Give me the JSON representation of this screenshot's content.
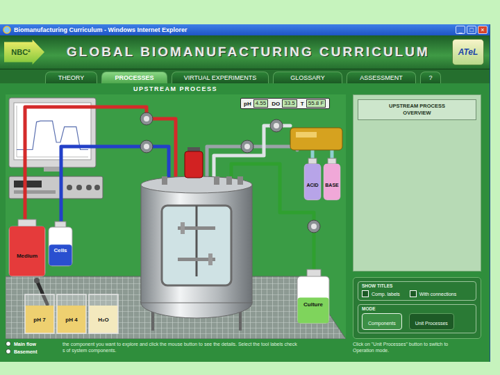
{
  "window": {
    "title": "Biomanufacturing Curriculum - Windows Internet Explorer",
    "controls": [
      "_",
      "□",
      "×"
    ]
  },
  "header": {
    "logo_left": "NBC²",
    "title": "GLOBAL BIOMANUFACTURING CURRICULUM",
    "logo_right": "ATeL"
  },
  "tabs": [
    {
      "label": "THEORY",
      "selected": false
    },
    {
      "label": "PROCESSES",
      "selected": true
    },
    {
      "label": "VIRTUAL EXPERIMENTS",
      "selected": false
    },
    {
      "label": "GLOSSARY",
      "selected": false
    },
    {
      "label": "ASSESSMENT",
      "selected": false
    },
    {
      "label": "?",
      "selected": false
    }
  ],
  "section_title": "UPSTREAM PROCESS",
  "readouts": [
    {
      "label": "pH",
      "value": "4.55"
    },
    {
      "label": "DO",
      "value": "33.5"
    },
    {
      "label": "T",
      "value": "55.8 F"
    }
  ],
  "monitor": {
    "series": [
      {
        "values": [
          15,
          15,
          15,
          15,
          15,
          72,
          74,
          74,
          74,
          74,
          30,
          30,
          62,
          62,
          62,
          62,
          15,
          15,
          15
        ]
      }
    ]
  },
  "bottles": [
    {
      "label": "Medium",
      "color": "#e53b3b"
    },
    {
      "label": "Cells",
      "color": "#2a4fd0"
    },
    {
      "label": "ACID",
      "color": "#b7a4e8"
    },
    {
      "label": "BASE",
      "color": "#f0a8d8"
    },
    {
      "label": "Culture",
      "color": "#7fd45c"
    }
  ],
  "beakers": [
    {
      "label": "pH 7",
      "color": "#e8c040"
    },
    {
      "label": "pH 4",
      "color": "#e8c040"
    },
    {
      "label": "H₂O",
      "color": "#efe2a8"
    }
  ],
  "overview": {
    "title": "UPSTREAM PROCESS OVERVIEW"
  },
  "show_titles": {
    "title": "SHOW TITLES",
    "options": [
      {
        "label": "Comp. labels",
        "checked": false
      },
      {
        "label": "With connections",
        "checked": false
      }
    ]
  },
  "mode": {
    "title": "MODE",
    "buttons": [
      {
        "label": "Components",
        "selected": true
      },
      {
        "label": "Unit Processes",
        "selected": false
      }
    ]
  },
  "legend": [
    {
      "label": "Main flow"
    },
    {
      "label": "Basement"
    }
  ],
  "instructions": [
    "the component you want to explore and click the mouse button to see the details. Select the tool labels check",
    "s of system components."
  ],
  "hint": [
    "Click on \"Unit Processes\" button to switch to",
    "Operation mode."
  ]
}
